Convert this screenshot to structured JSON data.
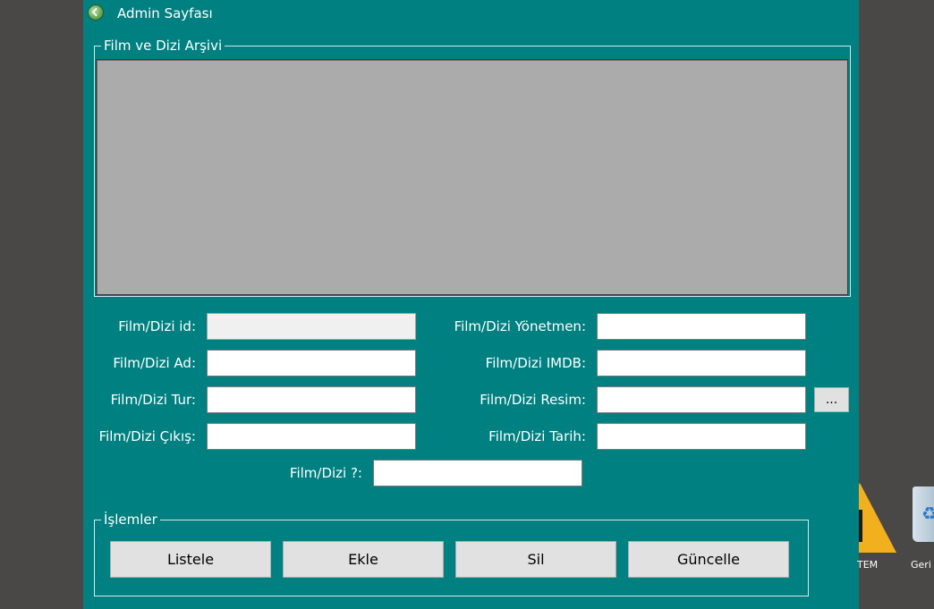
{
  "window": {
    "title": "Admin Sayfası",
    "bg_color": "#008080"
  },
  "archive_group": {
    "title": "Film ve Dizi Arşivi"
  },
  "form": {
    "id_label": "Film/Dizi id:",
    "id_value": "",
    "name_label": "Film/Dizi Ad:",
    "name_value": "",
    "type_label": "Film/Dizi Tur:",
    "type_value": "",
    "release_label": "Film/Dizi Çıkış:",
    "release_value": "",
    "director_label": "Film/Dizi Yönetmen:",
    "director_value": "",
    "imdb_label": "Film/Dizi IMDB:",
    "imdb_value": "",
    "image_label": "Film/Dizi Resim:",
    "image_value": "",
    "browse_label": "...",
    "date_label": "Film/Dizi Tarih:",
    "date_value": "",
    "kind_label": "Film/Dizi ?:",
    "kind_value": ""
  },
  "operations": {
    "title": "İşlemler",
    "list_label": "Listele",
    "add_label": "Ekle",
    "delete_label": "Sil",
    "update_label": "Güncelle"
  },
  "desktop": {
    "icon1_label": "TEM",
    "icon2_label": "Geri"
  }
}
